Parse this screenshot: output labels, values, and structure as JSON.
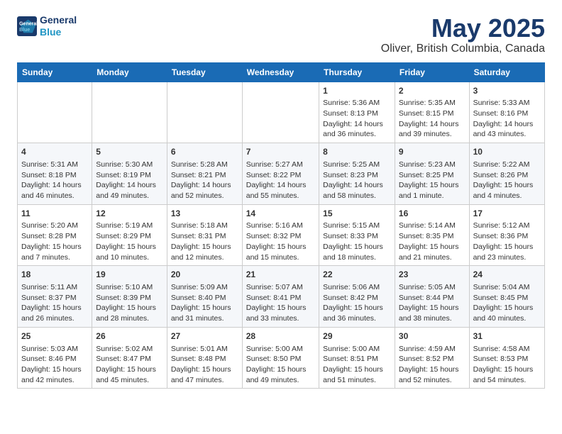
{
  "header": {
    "logo_line1": "General",
    "logo_line2": "Blue",
    "title": "May 2025",
    "subtitle": "Oliver, British Columbia, Canada"
  },
  "weekdays": [
    "Sunday",
    "Monday",
    "Tuesday",
    "Wednesday",
    "Thursday",
    "Friday",
    "Saturday"
  ],
  "weeks": [
    [
      {
        "day": "",
        "text": ""
      },
      {
        "day": "",
        "text": ""
      },
      {
        "day": "",
        "text": ""
      },
      {
        "day": "",
        "text": ""
      },
      {
        "day": "1",
        "text": "Sunrise: 5:36 AM\nSunset: 8:13 PM\nDaylight: 14 hours\nand 36 minutes."
      },
      {
        "day": "2",
        "text": "Sunrise: 5:35 AM\nSunset: 8:15 PM\nDaylight: 14 hours\nand 39 minutes."
      },
      {
        "day": "3",
        "text": "Sunrise: 5:33 AM\nSunset: 8:16 PM\nDaylight: 14 hours\nand 43 minutes."
      }
    ],
    [
      {
        "day": "4",
        "text": "Sunrise: 5:31 AM\nSunset: 8:18 PM\nDaylight: 14 hours\nand 46 minutes."
      },
      {
        "day": "5",
        "text": "Sunrise: 5:30 AM\nSunset: 8:19 PM\nDaylight: 14 hours\nand 49 minutes."
      },
      {
        "day": "6",
        "text": "Sunrise: 5:28 AM\nSunset: 8:21 PM\nDaylight: 14 hours\nand 52 minutes."
      },
      {
        "day": "7",
        "text": "Sunrise: 5:27 AM\nSunset: 8:22 PM\nDaylight: 14 hours\nand 55 minutes."
      },
      {
        "day": "8",
        "text": "Sunrise: 5:25 AM\nSunset: 8:23 PM\nDaylight: 14 hours\nand 58 minutes."
      },
      {
        "day": "9",
        "text": "Sunrise: 5:23 AM\nSunset: 8:25 PM\nDaylight: 15 hours\nand 1 minute."
      },
      {
        "day": "10",
        "text": "Sunrise: 5:22 AM\nSunset: 8:26 PM\nDaylight: 15 hours\nand 4 minutes."
      }
    ],
    [
      {
        "day": "11",
        "text": "Sunrise: 5:20 AM\nSunset: 8:28 PM\nDaylight: 15 hours\nand 7 minutes."
      },
      {
        "day": "12",
        "text": "Sunrise: 5:19 AM\nSunset: 8:29 PM\nDaylight: 15 hours\nand 10 minutes."
      },
      {
        "day": "13",
        "text": "Sunrise: 5:18 AM\nSunset: 8:31 PM\nDaylight: 15 hours\nand 12 minutes."
      },
      {
        "day": "14",
        "text": "Sunrise: 5:16 AM\nSunset: 8:32 PM\nDaylight: 15 hours\nand 15 minutes."
      },
      {
        "day": "15",
        "text": "Sunrise: 5:15 AM\nSunset: 8:33 PM\nDaylight: 15 hours\nand 18 minutes."
      },
      {
        "day": "16",
        "text": "Sunrise: 5:14 AM\nSunset: 8:35 PM\nDaylight: 15 hours\nand 21 minutes."
      },
      {
        "day": "17",
        "text": "Sunrise: 5:12 AM\nSunset: 8:36 PM\nDaylight: 15 hours\nand 23 minutes."
      }
    ],
    [
      {
        "day": "18",
        "text": "Sunrise: 5:11 AM\nSunset: 8:37 PM\nDaylight: 15 hours\nand 26 minutes."
      },
      {
        "day": "19",
        "text": "Sunrise: 5:10 AM\nSunset: 8:39 PM\nDaylight: 15 hours\nand 28 minutes."
      },
      {
        "day": "20",
        "text": "Sunrise: 5:09 AM\nSunset: 8:40 PM\nDaylight: 15 hours\nand 31 minutes."
      },
      {
        "day": "21",
        "text": "Sunrise: 5:07 AM\nSunset: 8:41 PM\nDaylight: 15 hours\nand 33 minutes."
      },
      {
        "day": "22",
        "text": "Sunrise: 5:06 AM\nSunset: 8:42 PM\nDaylight: 15 hours\nand 36 minutes."
      },
      {
        "day": "23",
        "text": "Sunrise: 5:05 AM\nSunset: 8:44 PM\nDaylight: 15 hours\nand 38 minutes."
      },
      {
        "day": "24",
        "text": "Sunrise: 5:04 AM\nSunset: 8:45 PM\nDaylight: 15 hours\nand 40 minutes."
      }
    ],
    [
      {
        "day": "25",
        "text": "Sunrise: 5:03 AM\nSunset: 8:46 PM\nDaylight: 15 hours\nand 42 minutes."
      },
      {
        "day": "26",
        "text": "Sunrise: 5:02 AM\nSunset: 8:47 PM\nDaylight: 15 hours\nand 45 minutes."
      },
      {
        "day": "27",
        "text": "Sunrise: 5:01 AM\nSunset: 8:48 PM\nDaylight: 15 hours\nand 47 minutes."
      },
      {
        "day": "28",
        "text": "Sunrise: 5:00 AM\nSunset: 8:50 PM\nDaylight: 15 hours\nand 49 minutes."
      },
      {
        "day": "29",
        "text": "Sunrise: 5:00 AM\nSunset: 8:51 PM\nDaylight: 15 hours\nand 51 minutes."
      },
      {
        "day": "30",
        "text": "Sunrise: 4:59 AM\nSunset: 8:52 PM\nDaylight: 15 hours\nand 52 minutes."
      },
      {
        "day": "31",
        "text": "Sunrise: 4:58 AM\nSunset: 8:53 PM\nDaylight: 15 hours\nand 54 minutes."
      }
    ]
  ]
}
